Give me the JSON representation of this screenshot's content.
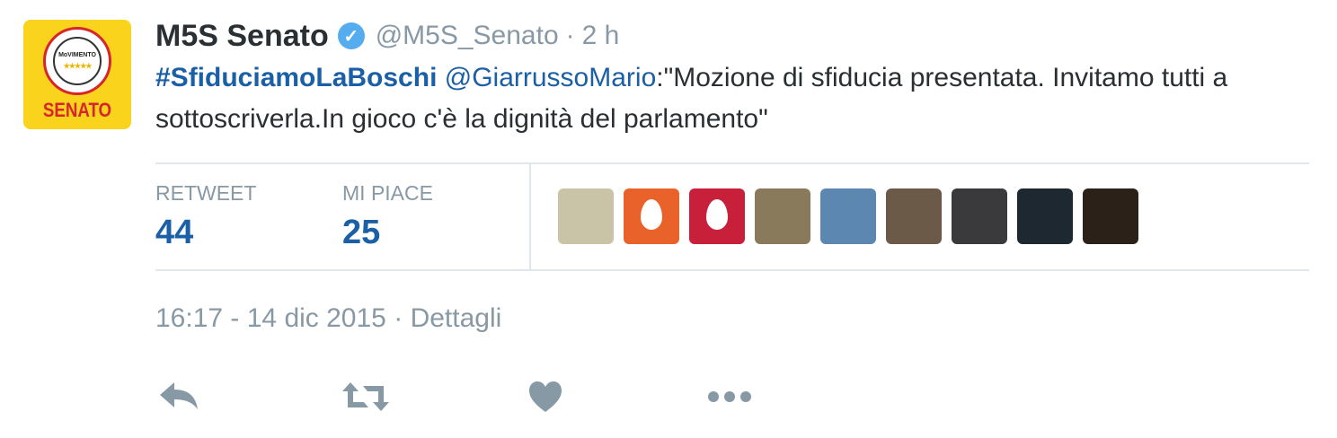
{
  "account": {
    "name": "M5S Senato",
    "handle": "@M5S_Senato",
    "time_ago": "2 h",
    "verified_glyph": "✓",
    "avatar_seal_text": "MoVIMENTO",
    "avatar_stars": "★★★★★",
    "avatar_label": "SENATO"
  },
  "tweet": {
    "hashtag": "#SfiduciamoLaBoschi",
    "mention": "@GiarrussoMario",
    "text": ":\"Mozione di sfiducia presentata. Invitamo tutti a sottoscriverla.In gioco c'è la dignità del parlamento\""
  },
  "stats": {
    "retweet_label": "RETWEET",
    "retweet_count": "44",
    "likes_label": "MI PIACE",
    "likes_count": "25"
  },
  "likers": [
    {
      "bg": "#c9c4a8"
    },
    {
      "bg": "#e8622a",
      "egg": true
    },
    {
      "bg": "#c81f3b",
      "egg": true
    },
    {
      "bg": "#8a7a5c"
    },
    {
      "bg": "#5b87b0"
    },
    {
      "bg": "#6b5a48"
    },
    {
      "bg": "#3a3a3c"
    },
    {
      "bg": "#1e2830"
    },
    {
      "bg": "#2b2118"
    }
  ],
  "footer": {
    "timestamp": "16:17 - 14 dic 2015",
    "separator": "·",
    "details": "Dettagli"
  },
  "colors": {
    "link": "#1b5fa6",
    "muted": "#8899a6",
    "action": "#8899a6",
    "avatar_bg": "#f9d31c"
  },
  "icons": [
    "reply-icon",
    "retweet-icon",
    "like-icon",
    "more-icon"
  ]
}
